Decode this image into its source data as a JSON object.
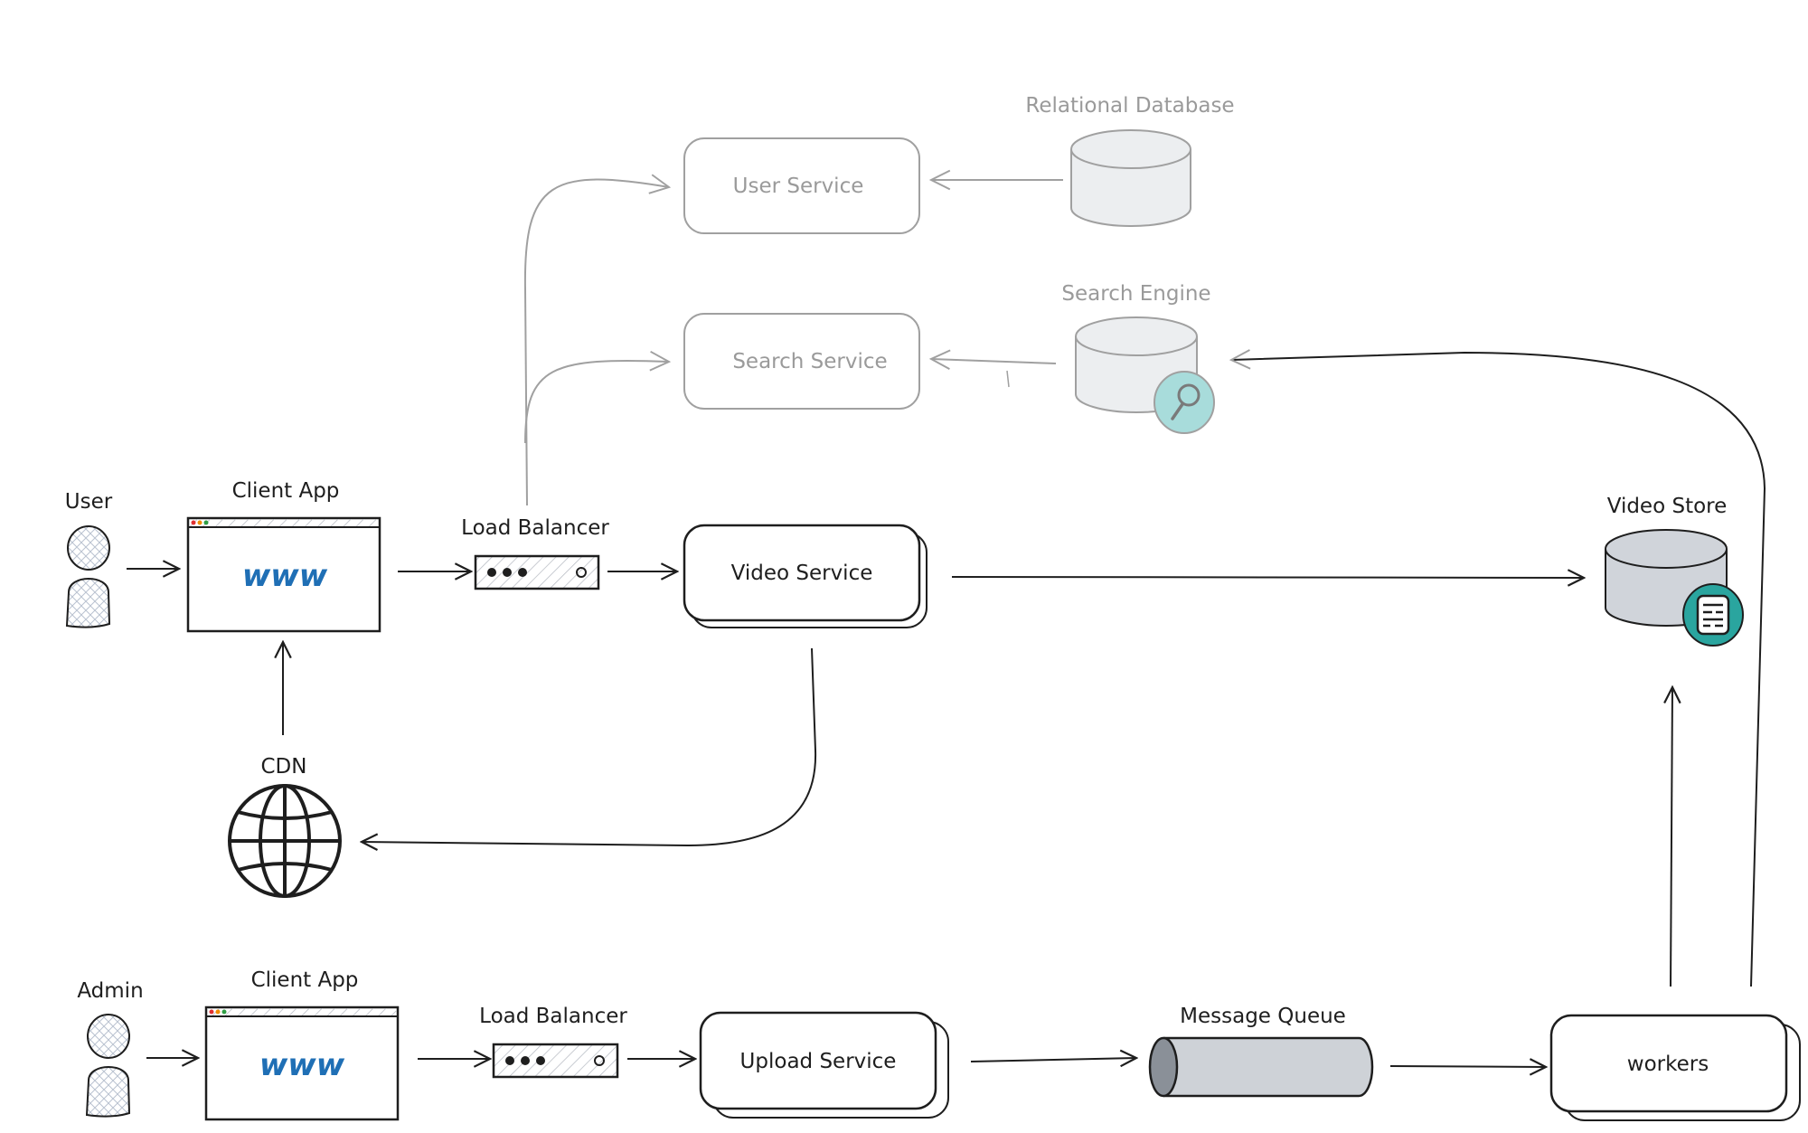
{
  "colors": {
    "stroke": "#1e1e1e",
    "muted_stroke": "#a0a0a0",
    "muted_text": "#9a9a9a",
    "www": "#1f6fb5",
    "cylinder_fill": "#eceef0",
    "video_store_fill": "#d0d4da",
    "queue_fill": "#ced2d7",
    "search_badge": "#a8dcdb",
    "store_badge": "#2aa59f"
  },
  "nodes": {
    "user": {
      "label": "User",
      "icon": "person-icon"
    },
    "admin": {
      "label": "Admin",
      "icon": "person-icon"
    },
    "client_app_top": {
      "label": "Client App",
      "content": "www"
    },
    "client_app_bottom": {
      "label": "Client App",
      "content": "www"
    },
    "load_balancer_top": {
      "label": "Load Balancer"
    },
    "load_balancer_bottom": {
      "label": "Load Balancer"
    },
    "video_service": {
      "label": "Video Service"
    },
    "upload_service": {
      "label": "Upload Service"
    },
    "user_service": {
      "label": "User Service"
    },
    "search_service": {
      "label": "Search Service"
    },
    "relational_database": {
      "label": "Relational Database"
    },
    "search_engine": {
      "label": "Search Engine",
      "icon": "magnifier-icon"
    },
    "video_store": {
      "label": "Video Store",
      "icon": "document-icon"
    },
    "cdn": {
      "label": "CDN",
      "icon": "globe-icon"
    },
    "message_queue": {
      "label": "Message Queue"
    },
    "workers": {
      "label": "workers"
    }
  }
}
